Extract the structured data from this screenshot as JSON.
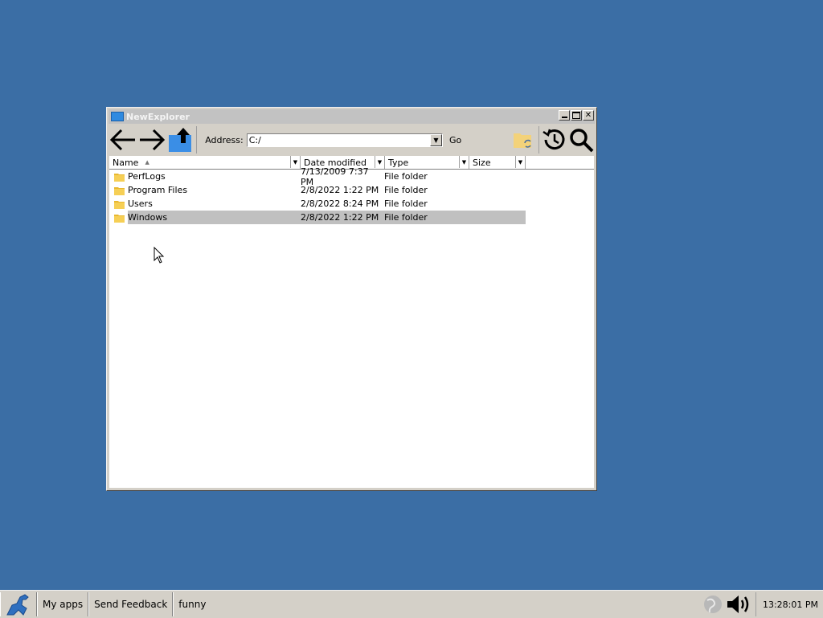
{
  "window": {
    "title": "NewExplorer",
    "icons": {
      "back": "back-arrow-icon",
      "forward": "forward-arrow-icon",
      "up": "up-folder-icon",
      "sync": "folder-sync-icon",
      "history": "history-icon",
      "search": "search-icon"
    },
    "address_label": "Address:",
    "address_value": "C:/",
    "go_label": "Go",
    "columns": [
      "Name",
      "Date modified",
      "Type",
      "Size"
    ],
    "rows": [
      {
        "name": "PerfLogs",
        "date": "7/13/2009 7:37 PM",
        "type": "File folder",
        "size": ""
      },
      {
        "name": "Program Files",
        "date": "2/8/2022 1:22 PM",
        "type": "File folder",
        "size": ""
      },
      {
        "name": "Users",
        "date": "2/8/2022 8:24 PM",
        "type": "File folder",
        "size": ""
      },
      {
        "name": "Windows",
        "date": "2/8/2022 1:22 PM",
        "type": "File folder",
        "size": "",
        "selected": true
      }
    ]
  },
  "taskbar": {
    "start_icon": "dinosaur-logo-icon",
    "items": [
      "My apps",
      "Send Feedback",
      "funny"
    ],
    "tray_icons": [
      "network-globe-icon",
      "volume-icon"
    ],
    "clock": "13:28:01 PM"
  },
  "colors": {
    "desktop": "#3b6ea5",
    "chrome": "#d4d0c8",
    "selection": "#c0c0c0",
    "folder": "#f0c040"
  }
}
